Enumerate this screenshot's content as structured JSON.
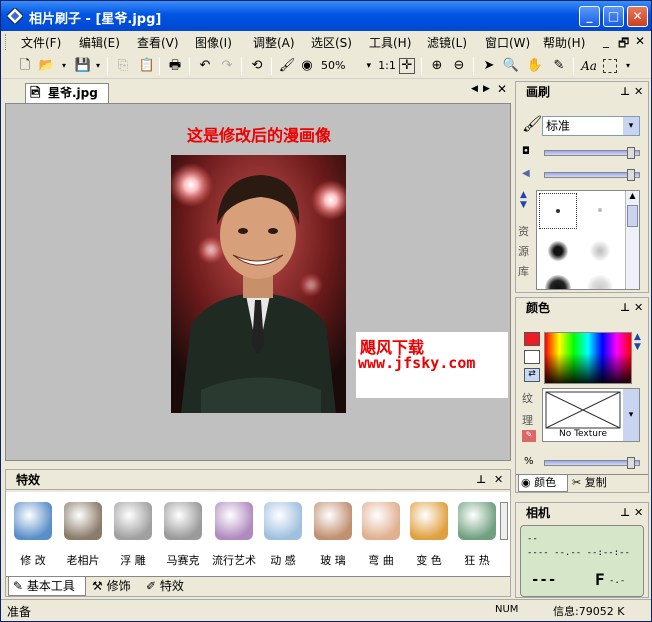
{
  "window": {
    "title": "相片刷子 - [星爷.jpg]",
    "btn_min": "_",
    "btn_max": "□",
    "btn_close": "✕"
  },
  "menu": {
    "items": [
      "文件(F)",
      "编辑(E)",
      "查看(V)",
      "图像(I)",
      "调整(A)",
      "选区(S)",
      "工具(H)",
      "滤镜(L)",
      "窗口(W)",
      "帮助(H)"
    ],
    "mdi_min": "_",
    "mdi_restore": "🗗",
    "mdi_close": "✕"
  },
  "toolbar": {
    "zoom_value": "50%",
    "actual_size_label": "1:1",
    "text_tool_label": "Aa"
  },
  "document": {
    "tab_label": "星爷.jpg",
    "caption": "这是修改后的漫画像",
    "watermark_line1": "飓风下载",
    "watermark_line2": "www.jfsky.com"
  },
  "brush_panel": {
    "title": "画刷",
    "preset_value": "标准",
    "library_label": "资源库",
    "slider1": 0.95,
    "slider2": 0.95
  },
  "color_panel": {
    "title": "颜色",
    "texture_label": "纹理",
    "texture_value": "No Texture",
    "percent_label": "%",
    "tab_color": "颜色",
    "tab_clone": "复制",
    "foreground": "#ee1c24",
    "background": "#ffffff"
  },
  "camera_panel": {
    "title": "相机",
    "line1": "--",
    "line2": "---- --.-- --:--:--",
    "big_left": "---",
    "big_right": "F",
    "big_right_small": "-.-"
  },
  "effects_panel": {
    "title": "特效",
    "items": [
      {
        "label": "修 改",
        "icon": "brush-edit-icon",
        "color": "#5a8ec8"
      },
      {
        "label": "老相片",
        "icon": "old-photo-icon",
        "color": "#8a7b6a"
      },
      {
        "label": "浮 雕",
        "icon": "emboss-icon",
        "color": "#a0a0a0"
      },
      {
        "label": "马赛克",
        "icon": "mosaic-icon",
        "color": "#9a9a9a"
      },
      {
        "label": "流行艺术",
        "icon": "pop-art-icon",
        "color": "#b08ac0"
      },
      {
        "label": "动 感",
        "icon": "motion-icon",
        "color": "#a0c0e0"
      },
      {
        "label": "玻 璃",
        "icon": "glass-icon",
        "color": "#c09070"
      },
      {
        "label": "弯 曲",
        "icon": "warp-icon",
        "color": "#e0b090"
      },
      {
        "label": "变 色",
        "icon": "recolor-icon",
        "color": "#e0a040"
      },
      {
        "label": "狂 热",
        "icon": "frenzy-icon",
        "color": "#70a080"
      }
    ],
    "bottom_tabs": [
      "基本工具",
      "修饰",
      "特效"
    ]
  },
  "status": {
    "left": "准备",
    "num": "NUM",
    "info": "信息:79052 K"
  }
}
